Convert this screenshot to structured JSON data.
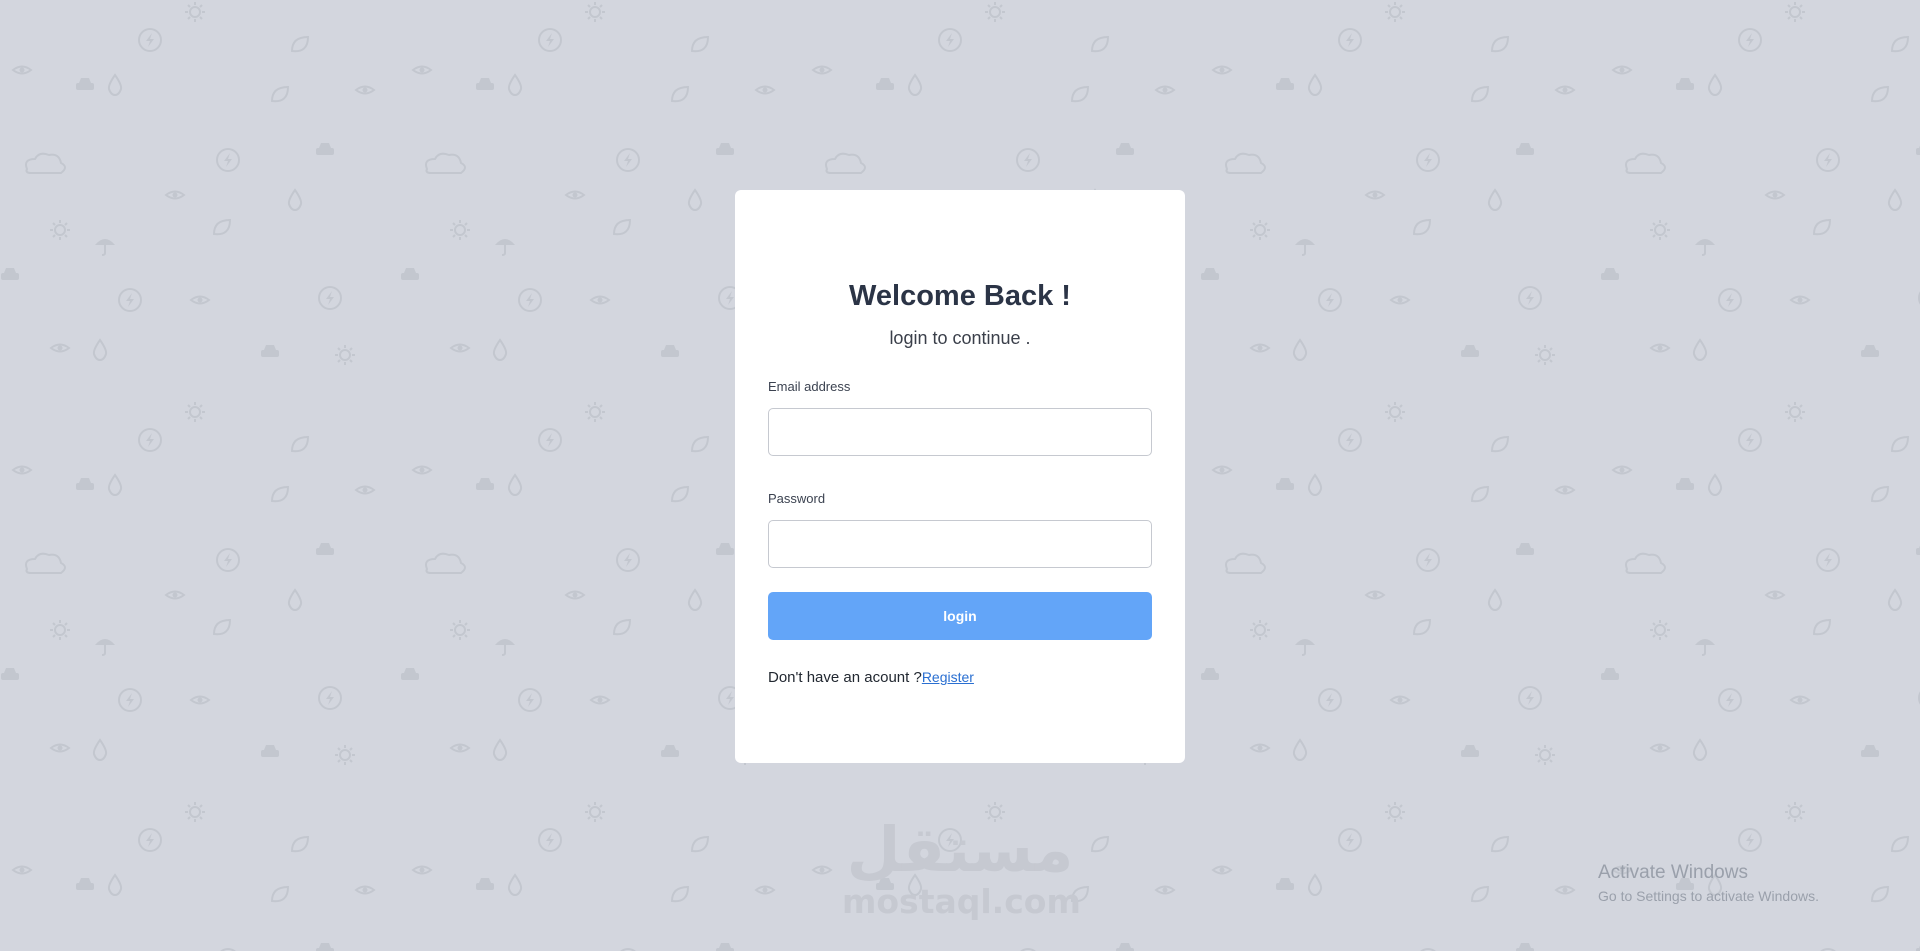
{
  "login": {
    "title": "Welcome Back !",
    "subtitle": "login to continue .",
    "email_label": "Email address",
    "email_value": "",
    "password_label": "Password",
    "password_value": "",
    "submit_label": "login",
    "register_prompt": "Don't have an acount ?",
    "register_link": "Register"
  },
  "watermark": {
    "arabic": "مستقل",
    "latin": "mostaql.com"
  },
  "os_notice": {
    "title": "Activate Windows",
    "subtitle": "Go to Settings to activate Windows."
  },
  "colors": {
    "background": "#d3d6de",
    "pattern_icon": "#c3c7cf",
    "card": "#ffffff",
    "primary_button": "#63a5f8",
    "link": "#2a6fd1",
    "title": "#2b3446"
  },
  "background_icons": [
    "eye-icon",
    "car-icon",
    "sun-icon",
    "umbrella-icon",
    "lightning-icon",
    "drop-icon",
    "cloud-icon",
    "leaf-icon"
  ]
}
